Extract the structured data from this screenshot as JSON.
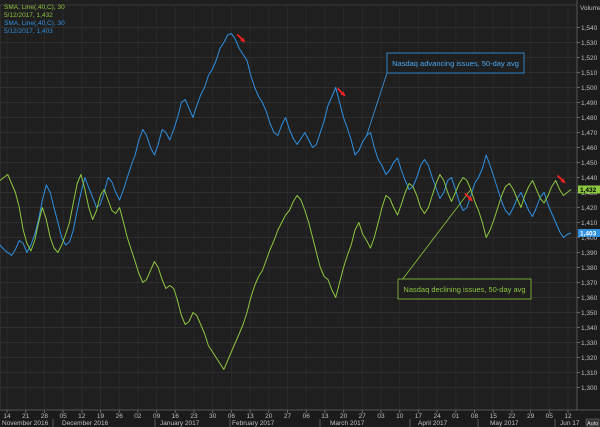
{
  "chart_data": {
    "type": "line",
    "title": "",
    "xlabel": "",
    "ylabel": "Volume",
    "ylim": [
      1285,
      1555
    ],
    "grid": true,
    "legend_position": "top-left",
    "legend": [
      {
        "name": "SMA, Line(,40,C), 30",
        "color": "#8dc63f"
      },
      {
        "name": "5/12/2017, 1,432",
        "color": "#8dc63f"
      },
      {
        "name": "SMA, Line(,40,C), 30",
        "color": "#2f8fe0"
      },
      {
        "name": "5/12/2017, 1,403",
        "color": "#2f8fe0"
      }
    ],
    "y_ticks": [
      1300,
      1310,
      1320,
      1330,
      1340,
      1350,
      1360,
      1370,
      1380,
      1390,
      1400,
      1410,
      1420,
      1430,
      1440,
      1450,
      1460,
      1470,
      1480,
      1490,
      1500,
      1510,
      1520,
      1530,
      1540
    ],
    "x_day_ticks": [
      "14",
      "21",
      "28",
      "05",
      "12",
      "19",
      "26",
      "02",
      "09",
      "16",
      "23",
      "30",
      "06",
      "13",
      "20",
      "27",
      "06",
      "13",
      "20",
      "27",
      "03",
      "10",
      "17",
      "24",
      "01",
      "08",
      "15",
      "22",
      "29",
      "05",
      "12"
    ],
    "x_month_labels": [
      "November 2016",
      "December 2016",
      "January 2017",
      "February 2017",
      "March 2017",
      "April 2017",
      "May 2017",
      "Jun 17"
    ],
    "x_sessions": 150,
    "last_values": {
      "green": "1,432",
      "blue": "1,403"
    },
    "series": [
      {
        "name": "Nasdaq advancing issues, 50-day avg",
        "color": "#2f8fe0",
        "values": [
          1395,
          1392,
          1390,
          1388,
          1392,
          1398,
          1396,
          1390,
          1395,
          1402,
          1412,
          1425,
          1435,
          1430,
          1420,
          1410,
          1400,
          1395,
          1397,
          1405,
          1418,
          1430,
          1440,
          1433,
          1427,
          1420,
          1422,
          1430,
          1440,
          1437,
          1430,
          1425,
          1432,
          1440,
          1448,
          1455,
          1465,
          1472,
          1468,
          1460,
          1455,
          1462,
          1472,
          1470,
          1465,
          1472,
          1480,
          1490,
          1492,
          1486,
          1480,
          1488,
          1495,
          1500,
          1508,
          1512,
          1518,
          1526,
          1530,
          1535,
          1536,
          1532,
          1526,
          1522,
          1518,
          1508,
          1500,
          1494,
          1490,
          1484,
          1476,
          1470,
          1468,
          1475,
          1480,
          1472,
          1466,
          1462,
          1466,
          1470,
          1465,
          1460,
          1462,
          1470,
          1478,
          1488,
          1494,
          1500,
          1490,
          1480,
          1473,
          1465,
          1455,
          1458,
          1464,
          1468,
          1470,
          1460,
          1452,
          1448,
          1442,
          1445,
          1450,
          1453,
          1445,
          1438,
          1432,
          1434,
          1440,
          1448,
          1452,
          1448,
          1440,
          1433,
          1426,
          1430,
          1438,
          1440,
          1432,
          1424,
          1418,
          1420,
          1428,
          1436,
          1440,
          1446,
          1455,
          1448,
          1440,
          1432,
          1424,
          1418,
          1415,
          1420,
          1426,
          1430,
          1424,
          1418,
          1414,
          1420,
          1427,
          1430,
          1422,
          1416,
          1410,
          1404,
          1400,
          1402,
          1403
        ]
      },
      {
        "name": "Nasdaq declining issues, 50-day avg",
        "color": "#8dc63f",
        "values": [
          1438,
          1440,
          1442,
          1436,
          1430,
          1420,
          1405,
          1396,
          1391,
          1398,
          1410,
          1420,
          1412,
          1400,
          1393,
          1390,
          1395,
          1402,
          1410,
          1423,
          1436,
          1442,
          1432,
          1420,
          1412,
          1418,
          1428,
          1432,
          1425,
          1418,
          1416,
          1420,
          1410,
          1400,
          1392,
          1384,
          1376,
          1370,
          1372,
          1378,
          1384,
          1380,
          1372,
          1366,
          1368,
          1366,
          1358,
          1348,
          1342,
          1344,
          1350,
          1348,
          1342,
          1336,
          1328,
          1324,
          1320,
          1316,
          1312,
          1318,
          1324,
          1330,
          1336,
          1342,
          1350,
          1360,
          1368,
          1374,
          1378,
          1385,
          1392,
          1398,
          1405,
          1410,
          1415,
          1418,
          1424,
          1428,
          1425,
          1418,
          1410,
          1400,
          1390,
          1380,
          1374,
          1372,
          1365,
          1360,
          1370,
          1380,
          1388,
          1395,
          1405,
          1410,
          1402,
          1398,
          1393,
          1400,
          1410,
          1420,
          1428,
          1426,
          1420,
          1415,
          1422,
          1430,
          1436,
          1434,
          1428,
          1420,
          1416,
          1420,
          1428,
          1436,
          1442,
          1438,
          1430,
          1424,
          1430,
          1436,
          1440,
          1438,
          1432,
          1424,
          1418,
          1410,
          1400,
          1405,
          1412,
          1420,
          1428,
          1434,
          1436,
          1432,
          1426,
          1420,
          1428,
          1434,
          1438,
          1432,
          1426,
          1423,
          1428,
          1434,
          1438,
          1432,
          1428,
          1430,
          1432
        ]
      }
    ],
    "annotations": [
      {
        "text": "Nasdaq advancing issues, 50-day avg",
        "series": "blue",
        "session": 95,
        "color": "#3a9ae8"
      },
      {
        "text": "Nasdaq declining issues, 50-day avg",
        "series": "green",
        "session": 140,
        "color": "#8dc63f"
      }
    ],
    "red_arrows": [
      {
        "session": 62,
        "series": "blue"
      },
      {
        "session": 88,
        "series": "blue"
      },
      {
        "session": 121,
        "series": "blue"
      },
      {
        "session": 145,
        "series": "green"
      }
    ]
  }
}
